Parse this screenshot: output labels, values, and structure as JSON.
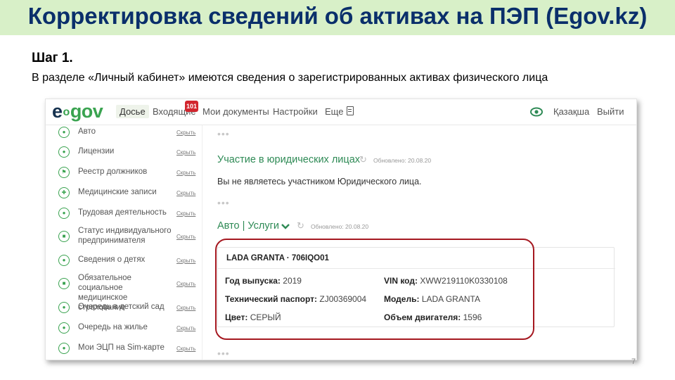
{
  "slide": {
    "title": "Корректировка сведений об активах на ПЭП (Egov.kz)",
    "step_title": "Шаг 1.",
    "step_desc": "В разделе «Личный кабинет»  имеются сведения о зарегистрированных активах  физического лица",
    "page_number": "7"
  },
  "colors": {
    "banner_bg": "#d8f0c8",
    "title_color": "#0a2f6b",
    "accent_green": "#3aa350",
    "highlight_red": "#a51820",
    "badge_red": "#d2252e"
  },
  "header": {
    "logo_e": "e",
    "logo_mid": "o",
    "logo_gov": "gov",
    "nav": [
      {
        "label": "Досье",
        "active": true
      },
      {
        "label": "Входящие",
        "badge": "101"
      },
      {
        "label": "Мои документы"
      },
      {
        "label": "Настройки"
      },
      {
        "label": "Еще"
      }
    ],
    "lang_label": "Қазақша",
    "logout_label": "Выйти",
    "icons": [
      "document-icon",
      "eye-icon"
    ]
  },
  "sidebar": {
    "hide_label": "Скрыть",
    "items": [
      {
        "label": "Авто",
        "icon": "car-icon"
      },
      {
        "label": "Лицензии",
        "icon": "license-icon"
      },
      {
        "label": "Реестр должников",
        "icon": "flag-icon"
      },
      {
        "label": "Медицинские записи",
        "icon": "medical-icon"
      },
      {
        "label": "Трудовая деятельность",
        "icon": "worker-icon"
      },
      {
        "label": "Статус индивидуального предпринимателя",
        "icon": "briefcase-icon"
      },
      {
        "label": "Сведения о детях",
        "icon": "children-icon"
      },
      {
        "label": "Обязательное социальное медицинское страхование",
        "icon": "insurance-icon"
      },
      {
        "label": "Очередь в детский сад",
        "icon": "kindergarten-icon"
      },
      {
        "label": "Очередь на жилье",
        "icon": "housing-icon"
      },
      {
        "label": "Мои ЭЦП на Sim-карте",
        "icon": "sim-icon"
      }
    ]
  },
  "main": {
    "dots": "•••",
    "legal_title": "Участие в юридических лицах",
    "legal_updated": "Обновлено: 20.08.20",
    "legal_text": "Вы не являетесь участником Юридического лица.",
    "auto_title": "Авто | Услуги",
    "auto_updated": "Обновлено: 20.08.20",
    "car": {
      "title": "LADA GRANTA · 706IQO01",
      "year_label": "Год выпуска:",
      "year": "2019",
      "passport_label": "Технический паспорт:",
      "passport": "ZJ00369004",
      "color_label": "Цвет:",
      "color": "СЕРЫЙ",
      "vin_label": "VIN код:",
      "vin": "XWW219110K0330108",
      "model_label": "Модель:",
      "model": "LADA GRANTA",
      "engine_label": "Объем двигателя:",
      "engine": "1596"
    }
  }
}
